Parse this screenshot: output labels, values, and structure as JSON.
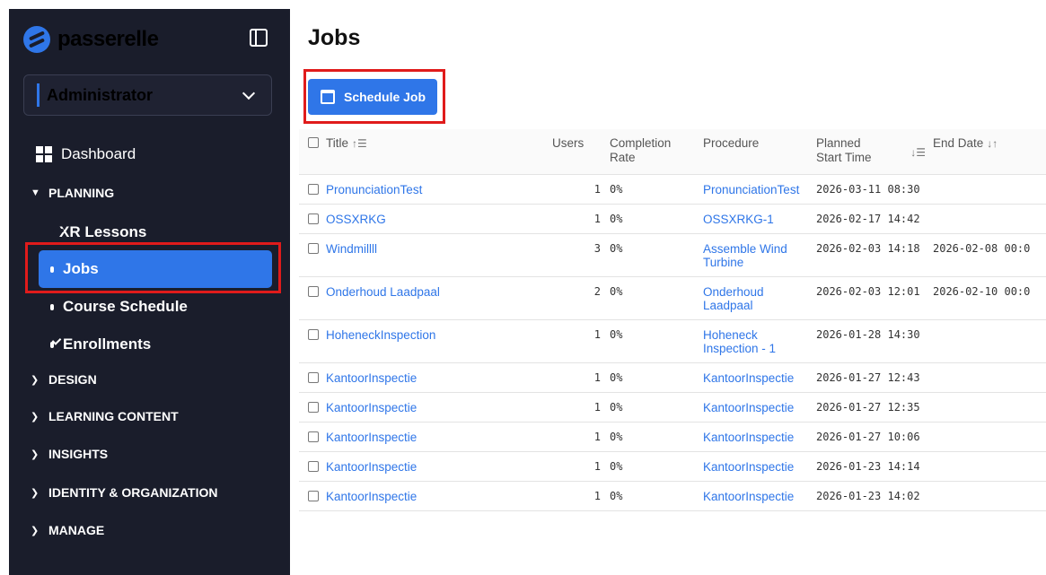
{
  "app": {
    "brand": "passerelle"
  },
  "role": {
    "selected": "Administrator"
  },
  "nav": {
    "dashboard": "Dashboard",
    "planning": "PLANNING",
    "planning_items": [
      "XR Lessons",
      "Jobs",
      "Course Schedule",
      "Enrollments"
    ],
    "sections": [
      "DESIGN",
      "LEARNING CONTENT",
      "INSIGHTS",
      "IDENTITY & ORGANIZATION",
      "MANAGE"
    ]
  },
  "page": {
    "title": "Jobs",
    "schedule_button": "Schedule Job"
  },
  "table": {
    "headers": {
      "title": "Title",
      "users": "Users",
      "completion_1": "Completion",
      "completion_2": "Rate",
      "procedure": "Procedure",
      "planned_1": "Planned",
      "planned_2": "Start Time",
      "end_date": "End Date"
    },
    "rows": [
      {
        "title": "PronunciationTest",
        "users": "1",
        "rate": "0%",
        "procedure": [
          "PronunciationTest"
        ],
        "start": "2026-03-11 08:30",
        "end": ""
      },
      {
        "title": "OSSXRKG",
        "users": "1",
        "rate": "0%",
        "procedure": [
          "OSSXRKG-1"
        ],
        "start": "2026-02-17 14:42",
        "end": ""
      },
      {
        "title": "Windmillll",
        "users": "3",
        "rate": "0%",
        "procedure": [
          "Assemble Wind",
          "Turbine"
        ],
        "start": "2026-02-03 14:18",
        "end": "2026-02-08 00:0"
      },
      {
        "title": "Onderhoud Laadpaal",
        "users": "2",
        "rate": "0%",
        "procedure": [
          "Onderhoud",
          "Laadpaal"
        ],
        "start": "2026-02-03 12:01",
        "end": "2026-02-10 00:0"
      },
      {
        "title": "HoheneckInspection",
        "users": "1",
        "rate": "0%",
        "procedure": [
          "Hoheneck",
          "Inspection - 1"
        ],
        "start": "2026-01-28 14:30",
        "end": ""
      },
      {
        "title": "KantoorInspectie",
        "users": "1",
        "rate": "0%",
        "procedure": [
          "KantoorInspectie"
        ],
        "start": "2026-01-27 12:43",
        "end": ""
      },
      {
        "title": "KantoorInspectie",
        "users": "1",
        "rate": "0%",
        "procedure": [
          "KantoorInspectie"
        ],
        "start": "2026-01-27 12:35",
        "end": ""
      },
      {
        "title": "KantoorInspectie",
        "users": "1",
        "rate": "0%",
        "procedure": [
          "KantoorInspectie"
        ],
        "start": "2026-01-27 10:06",
        "end": ""
      },
      {
        "title": "KantoorInspectie",
        "users": "1",
        "rate": "0%",
        "procedure": [
          "KantoorInspectie"
        ],
        "start": "2026-01-23 14:14",
        "end": ""
      },
      {
        "title": "KantoorInspectie",
        "users": "1",
        "rate": "0%",
        "procedure": [
          "KantoorInspectie"
        ],
        "start": "2026-01-23 14:02",
        "end": ""
      }
    ]
  },
  "colors": {
    "sidebar_bg": "#1a1d2b",
    "accent": "#2f76e8",
    "highlight": "#e01b1b"
  }
}
